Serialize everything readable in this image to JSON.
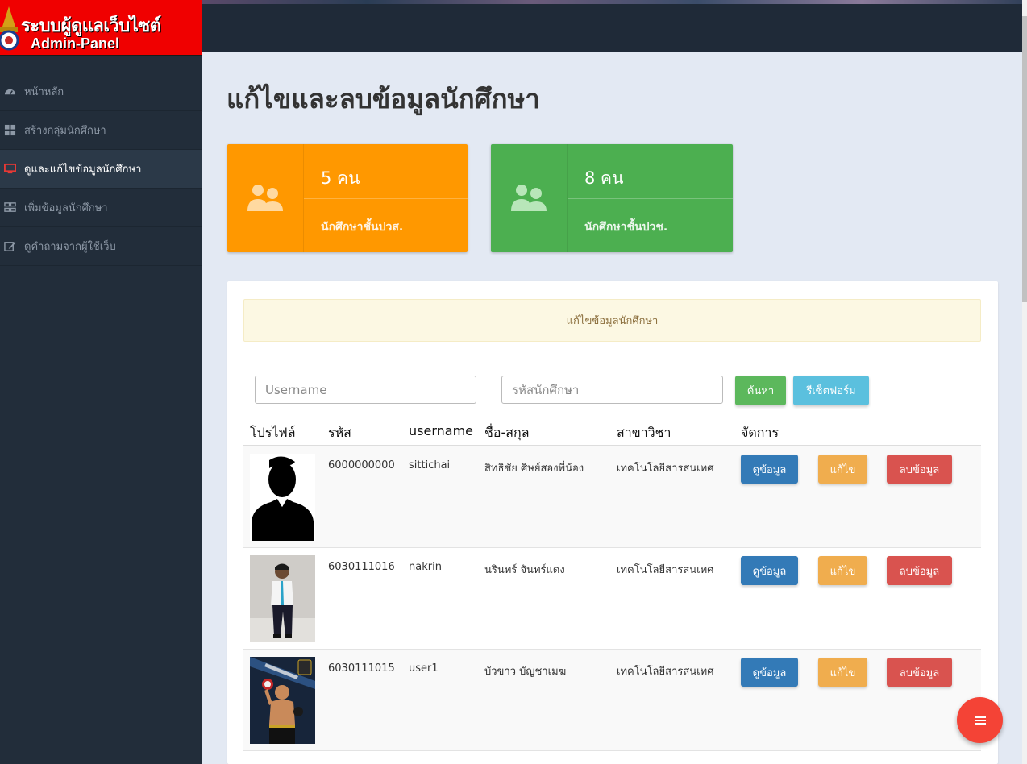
{
  "logo": {
    "line1": "ระบบผู้ดูแลเว็บไซต์",
    "line2": "Admin-Panel"
  },
  "sidebar": {
    "items": [
      {
        "label": "หน้าหลัก",
        "icon": "dashboard-icon",
        "active": false
      },
      {
        "label": "สร้างกลุ่มนักศึกษา",
        "icon": "grid-icon",
        "active": false
      },
      {
        "label": "ดูและแก้ไขข้อมูลนักศึกษา",
        "icon": "monitor-icon",
        "active": true
      },
      {
        "label": "เพิ่มข้อมูลนักศึกษา",
        "icon": "list-icon",
        "active": false
      },
      {
        "label": "ดูคำถามจากผู้ใช้เว็บ",
        "icon": "edit-icon",
        "active": false
      }
    ]
  },
  "page": {
    "title": "แก้ไขและลบข้อมูลนักศึกษา"
  },
  "stats": [
    {
      "count": "5 คน",
      "label": "นักศึกษาชั้นปวส.",
      "color": "#ff9800"
    },
    {
      "count": "8 คน",
      "label": "นักศึกษาชั้นปวช.",
      "color": "#4caf50"
    }
  ],
  "panel": {
    "alert": "แก้ไขข้อมูลนักศึกษา",
    "search": {
      "username_placeholder": "Username",
      "student_id_placeholder": "รหัสนักศึกษา",
      "search_label": "ค้นหา",
      "reset_label": "รีเซ็ตฟอร์ม"
    },
    "columns": [
      "โปรไฟล์",
      "รหัส",
      "username",
      "ชื่อ-สกุล",
      "สาขาวิชา",
      "จัดการ"
    ],
    "actions": {
      "view": "ดูข้อมูล",
      "edit": "แก้ไข",
      "delete": "ลบข้อมูล"
    },
    "rows": [
      {
        "id": "6000000000",
        "username": "sittichai",
        "name": "สิทธิชัย ศิษย์สองพี่น้อง",
        "major": "เทคโนโลยีสารสนเทศ"
      },
      {
        "id": "6030111016",
        "username": "nakrin",
        "name": "นรินทร์ จันทร์แดง",
        "major": "เทคโนโลยีสารสนเทศ"
      },
      {
        "id": "6030111015",
        "username": "user1",
        "name": "บัวขาว บัญชาเมฆ",
        "major": "เทคโนโลยีสารสนเทศ"
      }
    ]
  },
  "colors": {
    "sidebar_bg": "#222d3a",
    "logo_bg": "#f00000",
    "accent_red": "#f44336"
  }
}
